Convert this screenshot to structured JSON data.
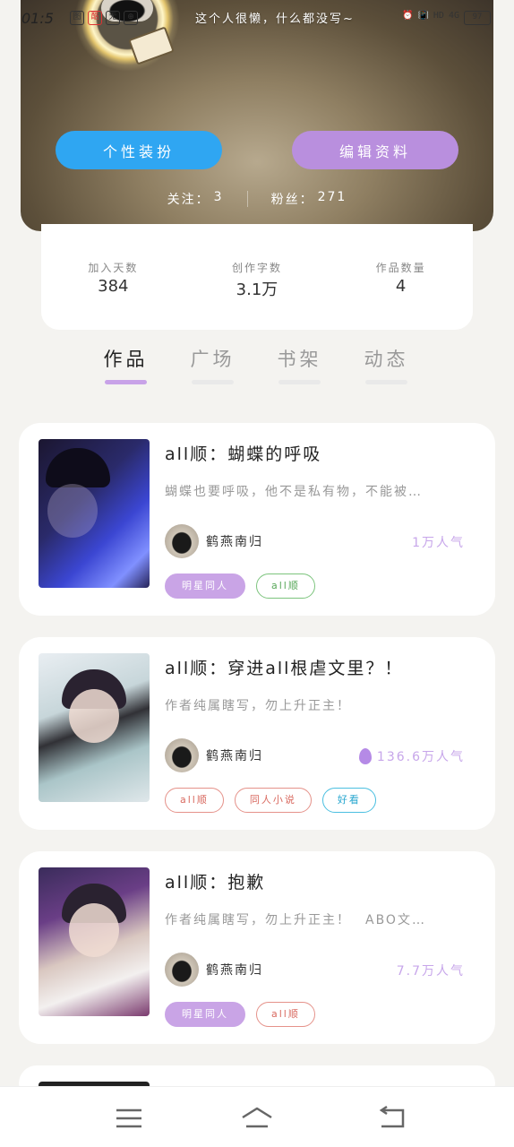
{
  "status_bar": {
    "time": "01:5",
    "left_icons": [
      "图",
      "酷",
      "无",
      "⊕"
    ],
    "right_icons": [
      "alarm-icon",
      "vibrate-icon",
      "HD",
      "4G",
      "97"
    ]
  },
  "profile": {
    "bio": "这个人很懒，什么都没写~",
    "dress_button": "个性装扮",
    "edit_button": "编辑资料",
    "following_label": "关注：",
    "following_value": "3",
    "followers_label": "粉丝：",
    "followers_value": "271"
  },
  "stats": [
    {
      "label": "加入天数",
      "value": "384"
    },
    {
      "label": "创作字数",
      "value": "3.1万"
    },
    {
      "label": "作品数量",
      "value": "4"
    }
  ],
  "tabs": [
    {
      "label": "作品",
      "active": true
    },
    {
      "label": "广场",
      "active": false
    },
    {
      "label": "书架",
      "active": false
    },
    {
      "label": "动态",
      "active": false
    }
  ],
  "works": [
    {
      "title": "all顺：蝴蝶的呼吸",
      "desc": "蝴蝶也要呼吸，他不是私有物，不能被…",
      "author": "鹤燕南归",
      "popularity": "1万人气",
      "hot": false,
      "tags": [
        {
          "label": "明星同人",
          "style": "purple"
        },
        {
          "label": "all顺",
          "style": "green"
        }
      ]
    },
    {
      "title": "all顺：穿进all根虐文里？！",
      "desc": "作者纯属瞎写，勿上升正主！",
      "author": "鹤燕南归",
      "popularity": "136.6万人气",
      "hot": true,
      "tags": [
        {
          "label": "all顺",
          "style": "red"
        },
        {
          "label": "同人小说",
          "style": "red"
        },
        {
          "label": "好看",
          "style": "blue"
        }
      ]
    },
    {
      "title": "all顺：抱歉",
      "desc": "作者纯属瞎写，勿上升正主！　ABO文…",
      "author": "鹤燕南归",
      "popularity": "7.7万人气",
      "hot": false,
      "tags": [
        {
          "label": "明星同人",
          "style": "purple"
        },
        {
          "label": "all顺",
          "style": "red"
        }
      ]
    }
  ],
  "colors": {
    "accent_blue": "#2fa6f2",
    "accent_purple": "#b98fde",
    "popularity": "#c7a6ea"
  }
}
